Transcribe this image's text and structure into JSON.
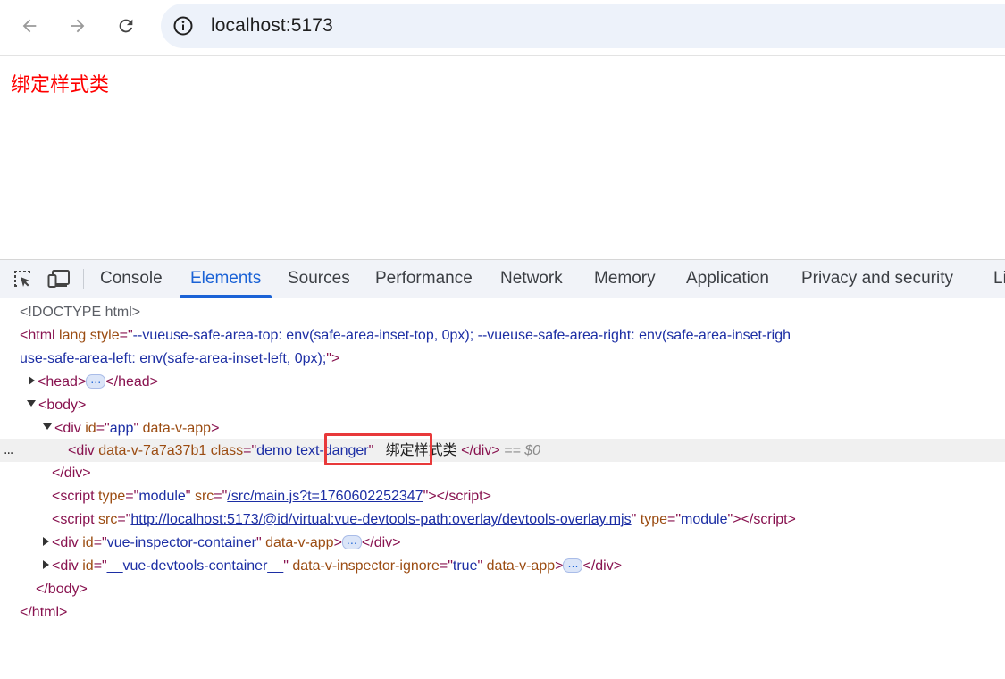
{
  "browser": {
    "back_label": "Back",
    "forward_label": "Forward",
    "reload_label": "Reload",
    "url": "localhost:5173",
    "site_info_icon": "info-icon"
  },
  "page": {
    "heading": "绑定样式类",
    "heading_color": "#ff0000"
  },
  "devtools": {
    "tool_icons": [
      "inspect-element-icon",
      "device-toolbar-icon"
    ],
    "tabs": [
      {
        "label": "Console",
        "active": false
      },
      {
        "label": "Elements",
        "active": true
      },
      {
        "label": "Sources",
        "active": false
      },
      {
        "label": "Performance",
        "active": false
      },
      {
        "label": "Network",
        "active": false
      },
      {
        "label": "Memory",
        "active": false
      },
      {
        "label": "Application",
        "active": false
      },
      {
        "label": "Privacy and security",
        "active": false
      },
      {
        "label": "Li",
        "active": false
      }
    ],
    "accent_color": "#1a62d6",
    "dom": {
      "doctype": "<!DOCTYPE html>",
      "html_style_value_1": "--vueuse-safe-area-top: env(safe-area-inset-top, 0px); --vueuse-safe-area-right: env(safe-area-inset-righ",
      "html_style_value_2": "use-safe-area-left: env(safe-area-inset-left, 0px);",
      "app_id": "app",
      "app_attr": "data-v-app",
      "selected_attr": "data-v-7a7a37b1",
      "selected_class_part1": "demo",
      "selected_class_part2": "text-danger",
      "selected_text": "绑定样式类",
      "selected_marker": "== $0",
      "script_type": "module",
      "script_src_1": "/src/main.js?t=1760602252347",
      "script_src_2": "http://localhost:5173/@id/virtual:vue-devtools-path:overlay/devtools-overlay.mjs",
      "inspector_id": "vue-inspector-container",
      "devtools_container_id": "__vue-devtools-container__",
      "inspector_ignore_attr": "data-v-inspector-ignore",
      "inspector_ignore_value": "true",
      "ellipsis": "…",
      "row_dots": "..."
    }
  }
}
